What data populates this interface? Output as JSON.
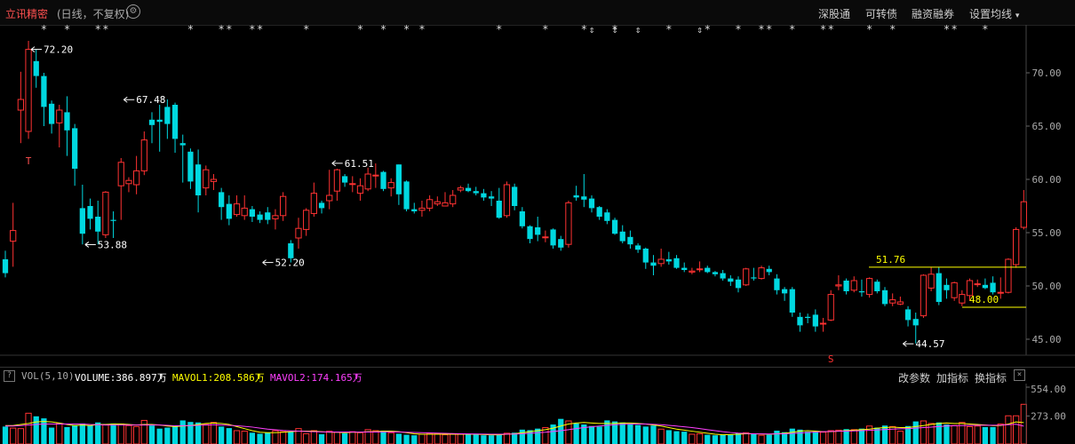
{
  "header": {
    "title": "立讯精密",
    "subtitle": "(日线，不复权)",
    "gear_icon": "gear-icon",
    "menu": [
      "深股通",
      "可转债",
      "融资融券",
      "设置均线"
    ]
  },
  "volume_panel": {
    "help_icon": "?",
    "indicator": "VOL(5,10)",
    "volume_label": "VOLUME:386.897万",
    "mavol1_label": "MAVOL1:208.586万",
    "mavol2_label": "MAVOL2:174.165万",
    "buttons": [
      "改参数",
      "加指标",
      "换指标"
    ],
    "close_icon": "×"
  },
  "colors": {
    "up": "#ff3232",
    "down": "#00d8e0",
    "volume_label": "#ffffff",
    "mavol1": "#ffff00",
    "mavol2": "#ff40ff",
    "axis_text": "#aaaaaa",
    "annotation": "#ffffff",
    "range_line": "#ffff00"
  },
  "chart_data": {
    "type": "candlestick",
    "price_axis": {
      "ticks": [
        "70.00",
        "65.00",
        "60.00",
        "55.00",
        "50.00",
        "45.00"
      ],
      "ylim": [
        43.5,
        74.5
      ]
    },
    "volume_axis": {
      "ticks": [
        "554.00",
        "273.00"
      ],
      "ylim": [
        0,
        554
      ]
    },
    "annotations": {
      "high": "72.20",
      "peak2": "67.48",
      "peak3": "61.51",
      "low1": "53.88",
      "low2": "52.20",
      "low3": "44.57",
      "range_high": "51.76",
      "range_low": "48.00"
    },
    "markers": {
      "star": "*",
      "pin": "⇕",
      "t": "T",
      "s": "S"
    },
    "candles": [
      [
        52.5,
        51.2,
        53.3,
        50.8
      ],
      [
        54.2,
        55.2,
        57.8,
        51.8
      ],
      [
        66.5,
        67.5,
        70.1,
        63.4
      ],
      [
        64.5,
        72.2,
        73.0,
        63.8
      ],
      [
        71.1,
        69.7,
        72.2,
        68.6
      ],
      [
        69.7,
        66.8,
        70.0,
        65.0
      ],
      [
        67.1,
        65.2,
        67.4,
        64.3
      ],
      [
        65.3,
        66.5,
        67.0,
        63.0
      ],
      [
        66.3,
        64.6,
        67.8,
        62.2
      ],
      [
        64.8,
        61.0,
        65.2,
        59.4
      ],
      [
        57.3,
        54.9,
        59.5,
        53.9
      ],
      [
        57.5,
        56.3,
        58.2,
        55.3
      ],
      [
        56.5,
        55.1,
        58.0,
        53.9
      ],
      [
        54.8,
        58.8,
        58.9,
        54.5
      ],
      [
        56.2,
        56.1,
        57.0,
        54.5
      ],
      [
        59.4,
        61.6,
        62.0,
        56.2
      ],
      [
        59.6,
        59.9,
        60.2,
        58.8
      ],
      [
        59.5,
        60.8,
        62.2,
        58.6
      ],
      [
        60.8,
        63.7,
        64.5,
        60.4
      ],
      [
        65.6,
        65.1,
        66.3,
        63.4
      ],
      [
        65.6,
        65.4,
        67.0,
        62.6
      ],
      [
        66.8,
        65.2,
        67.5,
        63.8
      ],
      [
        67.0,
        63.8,
        67.2,
        62.5
      ],
      [
        63.4,
        63.2,
        64.2,
        59.7
      ],
      [
        62.6,
        59.8,
        62.9,
        59.1
      ],
      [
        61.4,
        58.5,
        62.8,
        56.9
      ],
      [
        59.2,
        60.9,
        61.3,
        58.5
      ],
      [
        59.8,
        60.0,
        60.5,
        59.0
      ],
      [
        58.8,
        57.4,
        59.2,
        56.2
      ],
      [
        57.7,
        56.3,
        58.5,
        55.7
      ],
      [
        56.7,
        57.7,
        58.5,
        56.5
      ],
      [
        56.6,
        57.3,
        58.5,
        56.2
      ],
      [
        57.2,
        56.5,
        57.5,
        56.0
      ],
      [
        56.7,
        56.2,
        57.0,
        55.9
      ],
      [
        56.9,
        56.2,
        57.4,
        55.8
      ],
      [
        56.3,
        56.6,
        57.2,
        55.3
      ],
      [
        56.6,
        58.4,
        58.8,
        56.1
      ],
      [
        54.0,
        52.6,
        54.3,
        52.2
      ],
      [
        54.5,
        55.4,
        56.4,
        53.5
      ],
      [
        55.3,
        57.1,
        57.3,
        54.7
      ],
      [
        56.8,
        58.7,
        59.7,
        56.5
      ],
      [
        57.8,
        57.3,
        58.0,
        56.8
      ],
      [
        58.0,
        58.5,
        60.9,
        57.2
      ],
      [
        58.9,
        60.9,
        61.0,
        58.0
      ],
      [
        60.3,
        59.7,
        60.5,
        59.3
      ],
      [
        59.6,
        59.6,
        60.3,
        58.8
      ],
      [
        58.7,
        59.4,
        60.1,
        58.0
      ],
      [
        59.1,
        60.5,
        61.1,
        58.9
      ],
      [
        60.4,
        60.4,
        61.5,
        59.2
      ],
      [
        60.7,
        59.1,
        60.8,
        58.9
      ],
      [
        59.2,
        59.7,
        60.1,
        58.4
      ],
      [
        61.4,
        58.6,
        61.4,
        57.6
      ],
      [
        59.8,
        57.2,
        59.9,
        57.0
      ],
      [
        57.2,
        57.0,
        57.8,
        56.8
      ],
      [
        57.1,
        57.3,
        58.0,
        56.5
      ],
      [
        57.3,
        58.1,
        58.5,
        57.0
      ],
      [
        57.7,
        57.9,
        58.4,
        57.5
      ],
      [
        57.5,
        57.8,
        58.8,
        57.5
      ],
      [
        57.7,
        58.5,
        59.0,
        57.4
      ],
      [
        59.0,
        59.2,
        59.4,
        58.8
      ],
      [
        59.2,
        58.9,
        59.6,
        58.8
      ],
      [
        58.9,
        58.7,
        59.3,
        58.5
      ],
      [
        58.7,
        58.3,
        59.1,
        58.0
      ],
      [
        58.4,
        58.2,
        58.9,
        57.5
      ],
      [
        58.0,
        56.4,
        59.2,
        56.3
      ],
      [
        56.6,
        59.5,
        59.8,
        56.4
      ],
      [
        59.3,
        57.5,
        59.6,
        57.1
      ],
      [
        57.0,
        55.6,
        57.4,
        55.4
      ],
      [
        55.6,
        54.4,
        55.7,
        54.0
      ],
      [
        55.5,
        54.8,
        56.5,
        54.2
      ],
      [
        54.6,
        54.6,
        55.2,
        54.1
      ],
      [
        55.3,
        53.8,
        55.4,
        53.5
      ],
      [
        54.4,
        53.6,
        54.7,
        53.3
      ],
      [
        53.9,
        57.8,
        58.0,
        53.6
      ],
      [
        58.5,
        58.3,
        59.4,
        58.0
      ],
      [
        58.4,
        58.1,
        60.5,
        57.4
      ],
      [
        58.2,
        57.3,
        58.5,
        56.9
      ],
      [
        57.4,
        56.5,
        57.5,
        56.2
      ],
      [
        56.9,
        56.1,
        57.2,
        55.8
      ],
      [
        56.2,
        54.9,
        56.4,
        54.8
      ],
      [
        55.1,
        54.2,
        55.7,
        54.0
      ],
      [
        54.6,
        53.9,
        55.2,
        53.5
      ],
      [
        53.8,
        53.4,
        54.0,
        53.1
      ],
      [
        53.5,
        52.2,
        53.6,
        51.6
      ],
      [
        52.2,
        51.9,
        52.9,
        51.0
      ],
      [
        52.1,
        52.5,
        53.5,
        51.8
      ],
      [
        52.5,
        52.3,
        53.2,
        52.0
      ],
      [
        52.6,
        51.7,
        52.9,
        51.6
      ],
      [
        51.7,
        51.5,
        52.2,
        51.3
      ],
      [
        51.3,
        51.4,
        51.7,
        51.1
      ],
      [
        51.6,
        51.6,
        52.3,
        51.3
      ],
      [
        51.7,
        51.3,
        51.9,
        51.2
      ],
      [
        51.3,
        51.1,
        51.4,
        50.9
      ],
      [
        51.2,
        50.7,
        51.5,
        50.5
      ],
      [
        50.7,
        50.4,
        51.0,
        50.0
      ],
      [
        50.6,
        49.8,
        50.9,
        49.4
      ],
      [
        50.1,
        51.6,
        51.7,
        50.0
      ],
      [
        50.8,
        50.7,
        51.7,
        50.5
      ],
      [
        50.7,
        51.7,
        51.9,
        50.6
      ],
      [
        51.6,
        51.3,
        51.9,
        51.0
      ],
      [
        50.7,
        49.6,
        51.1,
        49.2
      ],
      [
        49.7,
        49.3,
        49.9,
        48.6
      ],
      [
        49.7,
        47.5,
        49.9,
        47.1
      ],
      [
        47.1,
        46.3,
        47.5,
        45.7
      ],
      [
        47.1,
        47.0,
        47.4,
        46.5
      ],
      [
        47.3,
        46.2,
        47.8,
        45.7
      ],
      [
        46.5,
        46.5,
        47.0,
        45.7
      ],
      [
        46.8,
        49.2,
        49.6,
        46.7
      ],
      [
        50.0,
        50.1,
        51.0,
        49.6
      ],
      [
        50.5,
        49.5,
        50.7,
        49.2
      ],
      [
        49.6,
        50.5,
        50.9,
        49.4
      ],
      [
        49.5,
        49.4,
        50.6,
        49.0
      ],
      [
        49.2,
        50.7,
        50.8,
        48.9
      ],
      [
        50.4,
        49.5,
        50.6,
        49.3
      ],
      [
        49.6,
        48.3,
        49.9,
        48.1
      ],
      [
        48.4,
        48.7,
        49.3,
        48.1
      ],
      [
        48.3,
        48.5,
        49.0,
        48.2
      ],
      [
        47.8,
        46.8,
        48.1,
        46.2
      ],
      [
        46.9,
        46.3,
        47.5,
        44.6
      ],
      [
        47.2,
        51.0,
        51.1,
        47.0
      ],
      [
        49.8,
        51.1,
        51.8,
        49.5
      ],
      [
        51.2,
        48.5,
        51.8,
        48.2
      ],
      [
        50.1,
        49.6,
        50.7,
        48.8
      ],
      [
        48.9,
        50.3,
        50.4,
        48.6
      ],
      [
        48.4,
        49.2,
        49.6,
        48.1
      ],
      [
        49.1,
        50.5,
        50.7,
        48.6
      ],
      [
        50.2,
        50.2,
        50.6,
        49.9
      ],
      [
        50.1,
        49.8,
        50.7,
        49.7
      ],
      [
        50.3,
        49.4,
        50.9,
        49.2
      ],
      [
        49.4,
        49.4,
        50.8,
        48.8
      ],
      [
        49.4,
        52.5,
        52.6,
        49.3
      ],
      [
        52.0,
        55.3,
        55.5,
        51.7
      ],
      [
        55.5,
        57.9,
        59.0,
        55.3
      ]
    ],
    "volume": {
      "values": [
        170,
        155,
        150,
        300,
        270,
        250,
        160,
        200,
        165,
        185,
        200,
        180,
        210,
        190,
        200,
        195,
        180,
        170,
        230,
        180,
        150,
        160,
        175,
        230,
        215,
        210,
        190,
        210,
        170,
        155,
        130,
        125,
        110,
        100,
        110,
        130,
        120,
        120,
        150,
        100,
        130,
        95,
        125,
        115,
        105,
        120,
        110,
        140,
        130,
        130,
        110,
        100,
        90,
        85,
        95,
        105,
        100,
        90,
        95,
        95,
        95,
        100,
        85,
        85,
        90,
        105,
        110,
        140,
        135,
        150,
        160,
        190,
        245,
        225,
        200,
        190,
        175,
        170,
        230,
        220,
        210,
        190,
        185,
        170,
        180,
        145,
        135,
        125,
        120,
        95,
        100,
        90,
        85,
        90,
        95,
        105,
        110,
        95,
        85,
        90,
        130,
        115,
        150,
        140,
        120,
        120,
        115,
        130,
        135,
        145,
        140,
        150,
        175,
        160,
        180,
        170,
        125,
        175,
        220,
        225,
        200,
        210,
        190,
        180,
        210,
        170,
        175,
        165,
        165,
        195,
        275,
        275,
        387
      ],
      "mavol1": [
        180,
        180,
        190,
        200,
        215,
        220,
        215,
        205,
        190,
        180,
        185,
        180,
        190,
        190,
        195,
        195,
        190,
        185,
        190,
        190,
        185,
        175,
        170,
        175,
        180,
        190,
        200,
        205,
        200,
        190,
        170,
        150,
        130,
        115,
        110,
        110,
        115,
        120,
        125,
        125,
        125,
        120,
        115,
        115,
        110,
        115,
        115,
        120,
        120,
        125,
        125,
        120,
        110,
        100,
        95,
        95,
        95,
        95,
        95,
        95,
        95,
        95,
        92,
        90,
        90,
        95,
        100,
        110,
        120,
        130,
        140,
        155,
        175,
        195,
        205,
        210,
        205,
        200,
        200,
        200,
        205,
        205,
        200,
        195,
        185,
        175,
        160,
        145,
        135,
        125,
        115,
        105,
        95,
        90,
        92,
        95,
        100,
        100,
        97,
        95,
        100,
        105,
        115,
        125,
        130,
        125,
        120,
        120,
        125,
        130,
        135,
        140,
        145,
        155,
        160,
        165,
        160,
        160,
        170,
        180,
        190,
        200,
        205,
        200,
        200,
        195,
        190,
        185,
        180,
        180,
        195,
        215,
        209
      ],
      "mavol2": [
        175,
        175,
        180,
        185,
        190,
        195,
        195,
        195,
        195,
        195,
        195,
        190,
        188,
        185,
        185,
        185,
        185,
        185,
        185,
        185,
        185,
        182,
        178,
        178,
        180,
        182,
        185,
        188,
        185,
        182,
        178,
        172,
        165,
        155,
        145,
        138,
        132,
        128,
        125,
        122,
        120,
        118,
        117,
        117,
        117,
        117,
        116,
        117,
        117,
        118,
        118,
        117,
        115,
        112,
        110,
        108,
        106,
        104,
        102,
        100,
        98,
        97,
        96,
        95,
        95,
        96,
        97,
        100,
        105,
        110,
        115,
        122,
        130,
        140,
        150,
        160,
        168,
        175,
        182,
        188,
        192,
        195,
        195,
        195,
        192,
        188,
        182,
        175,
        168,
        160,
        150,
        140,
        130,
        120,
        112,
        106,
        103,
        100,
        98,
        97,
        98,
        100,
        103,
        107,
        112,
        116,
        120,
        122,
        124,
        126,
        128,
        130,
        133,
        137,
        141,
        145,
        148,
        150,
        155,
        160,
        165,
        170,
        175,
        178,
        180,
        182,
        183,
        183,
        183,
        184,
        188,
        193,
        174
      ]
    },
    "star_positions": [
      5,
      8,
      12,
      13,
      24,
      28,
      29,
      32,
      33,
      39,
      46,
      49,
      52,
      54,
      64,
      70,
      75,
      79,
      86,
      91,
      95,
      98,
      99,
      102,
      106,
      107,
      112,
      115,
      122,
      123,
      127
    ],
    "pin_positions": [
      76,
      79,
      82,
      90
    ]
  }
}
